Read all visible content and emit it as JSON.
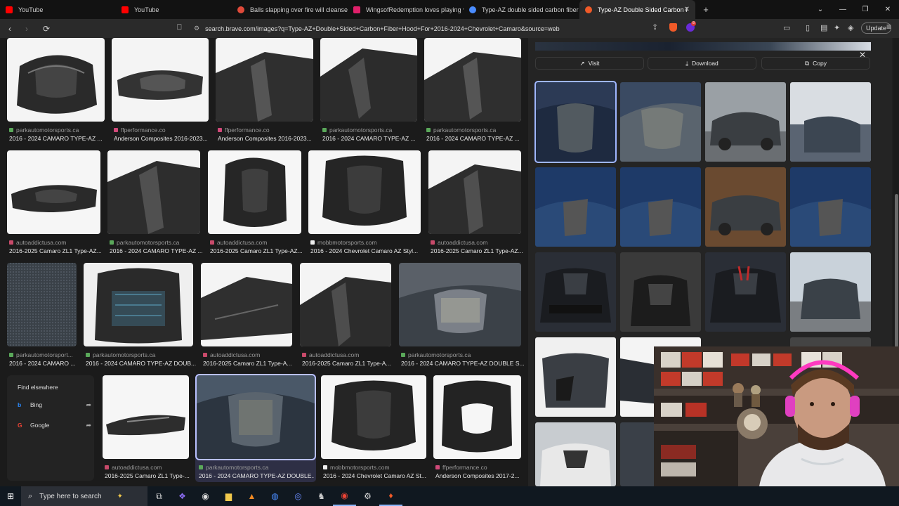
{
  "tabs": [
    {
      "title": "YouTube",
      "favicon_color": "#ff0000"
    },
    {
      "title": "YouTube",
      "favicon_color": "#ff0000"
    },
    {
      "title": "Balls slapping over fire will cleanse y",
      "favicon_color": "#e04a3a"
    },
    {
      "title": "WingsofRedemption loves playing vi",
      "favicon_color": "#e0206a"
    },
    {
      "title": "Type-AZ double sided carbon fiber h",
      "favicon_color": "#4a8cff"
    },
    {
      "title": "Type-AZ Double Sided Carbon F",
      "favicon_color": "#f05a28",
      "active": true
    }
  ],
  "new_tab_label": "+",
  "window_controls": {
    "minimize": "—",
    "maximize": "❐",
    "close": "✕",
    "sidebar": "⌄"
  },
  "address": {
    "url": "search.brave.com/images?q=Type-AZ+Double+Sided+Carbon+Fiber+Hood+For+2016-2024+Chevrolet+Camaro&source=web",
    "rewards_badge": "8",
    "update_label": "Update"
  },
  "results": [
    {
      "source": "parkautomotorsports.ca",
      "title": "2016 - 2024 CAMARO TYPE-AZ ...",
      "fav": "#5aa85a"
    },
    {
      "source": "ffperformance.co",
      "title": "Anderson Composites 2016-2023...",
      "fav": "#d24a7a"
    },
    {
      "source": "ffperformance.co",
      "title": "Anderson Composites 2016-2023...",
      "fav": "#d24a7a"
    },
    {
      "source": "parkautomotorsports.ca",
      "title": "2016 - 2024 CAMARO TYPE-AZ ...",
      "fav": "#5aa85a"
    },
    {
      "source": "parkautomotorsports.ca",
      "title": "2016 - 2024 CAMARO TYPE-AZ ...",
      "fav": "#5aa85a"
    },
    {
      "source": "autoaddictusa.com",
      "title": "2016-2025 Camaro ZL1 Type-AZ...",
      "fav": "#c84a6a"
    },
    {
      "source": "parkautomotorsports.ca",
      "title": "2016 - 2024 CAMARO TYPE-AZ ...",
      "fav": "#5aa85a"
    },
    {
      "source": "autoaddictusa.com",
      "title": "2016-2025 Camaro ZL1 Type-AZ...",
      "fav": "#c84a6a"
    },
    {
      "source": "mobbmotorsports.com",
      "title": "2016 - 2024 Chevrolet Camaro AZ Styl...",
      "fav": "#eeeeee"
    },
    {
      "source": "autoaddictusa.com",
      "title": "2016-2025 Camaro ZL1 Type-AZ...",
      "fav": "#c84a6a"
    },
    {
      "source": "parkautomotorsport...",
      "title": "2016 - 2024 CAMARO ...",
      "fav": "#5aa85a"
    },
    {
      "source": "parkautomotorsports.ca",
      "title": "2016 - 2024 CAMARO TYPE-AZ DOUB...",
      "fav": "#5aa85a"
    },
    {
      "source": "autoaddictusa.com",
      "title": "2016-2025 Camaro ZL1 Type-A...",
      "fav": "#c84a6a"
    },
    {
      "source": "autoaddictusa.com",
      "title": "2016-2025 Camaro ZL1 Type-A...",
      "fav": "#c84a6a"
    },
    {
      "source": "parkautomotorsports.ca",
      "title": "2016 - 2024 CAMARO TYPE-AZ DOUBLE S...",
      "fav": "#5aa85a"
    },
    {
      "source": "autoaddictusa.com",
      "title": "2016-2025 Camaro ZL1 Type-...",
      "fav": "#c84a6a"
    },
    {
      "source": "parkautomotorsports.ca",
      "title": "2016 - 2024 CAMARO TYPE-AZ DOUBLE...",
      "fav": "#5aa85a",
      "selected": true
    },
    {
      "source": "mobbmotorsports.com",
      "title": "2016 - 2024 Chevrolet Camaro AZ St...",
      "fav": "#eeeeee"
    },
    {
      "source": "ffperformance.co",
      "title": "Anderson Composites 2017-2...",
      "fav": "#d24a7a"
    }
  ],
  "find_elsewhere": {
    "heading": "Find elsewhere",
    "items": [
      {
        "label": "Bing",
        "icon": "b",
        "color": "#2b8cff"
      },
      {
        "label": "Google",
        "icon": "G",
        "color": "#ea4335"
      }
    ]
  },
  "detail": {
    "visit_label": "Visit",
    "download_label": "Download",
    "copy_label": "Copy"
  },
  "taskbar": {
    "search_placeholder": "Type here to search"
  }
}
